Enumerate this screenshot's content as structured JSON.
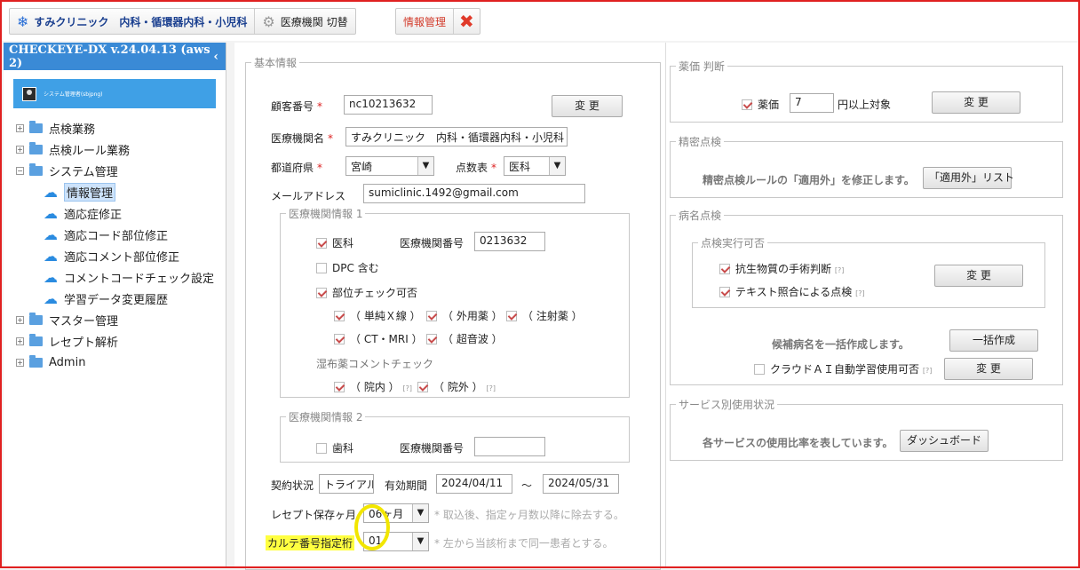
{
  "topbar": {
    "clinic_name": "すみクリニック　内科・循環器内科・小児科",
    "switch_label": "医療機関 切替",
    "info_label": "情報管理"
  },
  "sidebar": {
    "app_title": "CHECKEYE-DX v.24.04.13 (aws 2)",
    "user_label": "システム管理者(sbjpng)",
    "items": [
      {
        "label": "点検業務"
      },
      {
        "label": "点検ルール業務"
      },
      {
        "label": "システム管理"
      },
      {
        "label": "マスター管理"
      },
      {
        "label": "レセプト解析"
      },
      {
        "label": "Admin"
      }
    ],
    "children": [
      {
        "label": "情報管理"
      },
      {
        "label": "適応症修正"
      },
      {
        "label": "適応コード部位修正"
      },
      {
        "label": "適応コメント部位修正"
      },
      {
        "label": "コメントコードチェック設定"
      },
      {
        "label": "学習データ変更履歴"
      }
    ]
  },
  "basic": {
    "legend": "基本情報",
    "customer_no_label": "顧客番号",
    "customer_no": "nc10213632",
    "change_btn": "変 更",
    "facility_name_label": "医療機関名",
    "facility_name": "すみクリニック　内科・循環器内科・小児科",
    "pref_label": "都道府県",
    "pref_value": "宮崎",
    "points_label": "点数表",
    "points_value": "医科",
    "email_label": "メールアドレス",
    "email": "sumiclinic.1492@gmail.com",
    "info1": {
      "legend": "医療機関情報 1",
      "ika": "医科",
      "facility_no_label": "医療機関番号",
      "facility_no": "0213632",
      "dpc": "DPC 含む",
      "part_check": "部位チェック可否",
      "opts": [
        "（ 単純Ｘ線 ）",
        "（ 外用薬 ）",
        "（ 注射薬 ）",
        "（ CT・MRI ）",
        "（ 超音波 ）"
      ],
      "poultice_label": "湿布薬コメントチェック",
      "in_hosp": "（ 院内 ）",
      "out_hosp": "（ 院外 ）"
    },
    "info2": {
      "legend": "医療機関情報 2",
      "dental": "歯科",
      "facility_no_label": "医療機関番号",
      "facility_no": ""
    },
    "contract_label": "契約状況",
    "contract_value": "トライアル",
    "valid_label": "有効期間",
    "valid_from": "2024/04/11",
    "tilde": "～",
    "valid_to": "2024/05/31",
    "receipt_keep_label": "レセプト保存ヶ月",
    "receipt_keep_value": "06ヶ月",
    "receipt_keep_note": "* 取込後、指定ヶ月数以降に除去する。",
    "karte_label": "カルテ番号指定桁",
    "karte_value": "01",
    "karte_note": "* 左から当該桁まで同一患者とする。"
  },
  "drug": {
    "legend": "薬価 判断",
    "drug_label": "薬価",
    "drug_value": "7",
    "drug_suffix": "円以上対象",
    "change_btn": "変 更"
  },
  "precise": {
    "legend": "精密点検",
    "text": "精密点検ルールの「適用外」を修正します。",
    "btn": "「適用外」リスト"
  },
  "disease": {
    "legend": "病名点検",
    "sub_legend": "点検実行可否",
    "antibiotic": "抗生物質の手術判断",
    "text_match": "テキスト照合による点検",
    "change_btn": "変 更",
    "bulk_text": "候補病名を一括作成します。",
    "bulk_btn": "一括作成",
    "cloud_ai": "クラウドＡＩ自動学習使用可否",
    "change_btn2": "変 更"
  },
  "service": {
    "legend": "サービス別使用状況",
    "text": "各サービスの使用比率を表しています。",
    "btn": "ダッシュボード"
  },
  "hint": "[?]"
}
